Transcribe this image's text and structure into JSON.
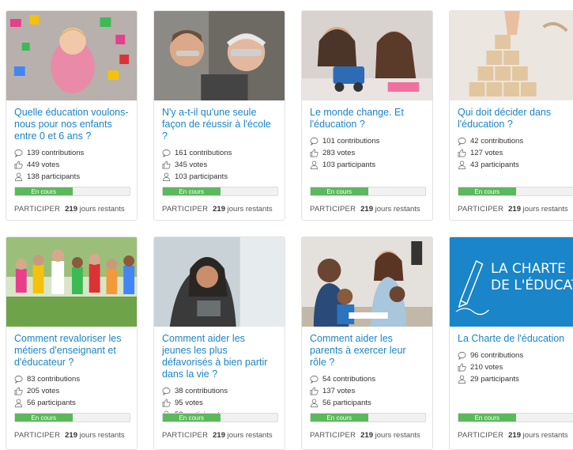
{
  "cards": [
    {
      "title": "Quelle éducation voulons-nous pour nos enfants entre 0 et 6 ans ?",
      "contributions": "139 contributions",
      "votes": "449 votes",
      "participants": "138 participants",
      "status": "En cours",
      "cta": "PARTICIPER",
      "days_num": "219",
      "days_label": "jours restants",
      "progress": 0.5
    },
    {
      "title": "N'y a-t-il qu'une seule façon de réussir à l'école ?",
      "contributions": "161 contributions",
      "votes": "345 votes",
      "participants": "103 participants",
      "status": "En cours",
      "cta": "PARTICIPER",
      "days_num": "219",
      "days_label": "jours restants",
      "progress": 0.5
    },
    {
      "title": "Le monde change. Et l'éducation ?",
      "contributions": "101 contributions",
      "votes": "283 votes",
      "participants": "103 participants",
      "status": "En cours",
      "cta": "PARTICIPER",
      "days_num": "219",
      "days_label": "jours restants",
      "progress": 0.5
    },
    {
      "title": "Qui doit décider dans l'éducation ?",
      "contributions": "42 contributions",
      "votes": "127 votes",
      "participants": "43 participants",
      "status": "En cours",
      "cta": "PARTICIPER",
      "days_num": "219",
      "days_label": "jours restants",
      "progress": 0.5
    },
    {
      "title": "Comment revaloriser les métiers d'enseignant et d'éducateur ?",
      "contributions": "83 contributions",
      "votes": "205 votes",
      "participants": "56 participants",
      "status": "En cours",
      "cta": "PARTICIPER",
      "days_num": "219",
      "days_label": "jours restants",
      "progress": 0.5
    },
    {
      "title": "Comment aider les jeunes les plus défavorisés à bien partir dans la vie ?",
      "contributions": "38 contributions",
      "votes": "95 votes",
      "participants": "58 participants",
      "status": "En cours",
      "cta": "PARTICIPER",
      "days_num": "219",
      "days_label": "jours restants",
      "progress": 0.5
    },
    {
      "title": "Comment aider les parents à exercer leur rôle ?",
      "contributions": "54 contributions",
      "votes": "137 votes",
      "participants": "56 participants",
      "status": "En cours",
      "cta": "PARTICIPER",
      "days_num": "219",
      "days_label": "jours restants",
      "progress": 0.5
    },
    {
      "title": "La Charte de l'éducation",
      "contributions": "96 contributions",
      "votes": "210 votes",
      "participants": "29 participants",
      "status": "En cours",
      "cta": "PARTICIPER",
      "days_num": "219",
      "days_label": "jours restants",
      "progress": 0.5,
      "banner_line1": "LA CHARTE",
      "banner_line2": "DE L'ÉDUCATION"
    }
  ],
  "icons": {
    "contributions": "speech-bubble-icon",
    "votes": "thumbs-up-icon",
    "participants": "person-icon"
  },
  "colors": {
    "link": "#1a85c8",
    "progress": "#5cb85c",
    "banner": "#1a85c8"
  }
}
